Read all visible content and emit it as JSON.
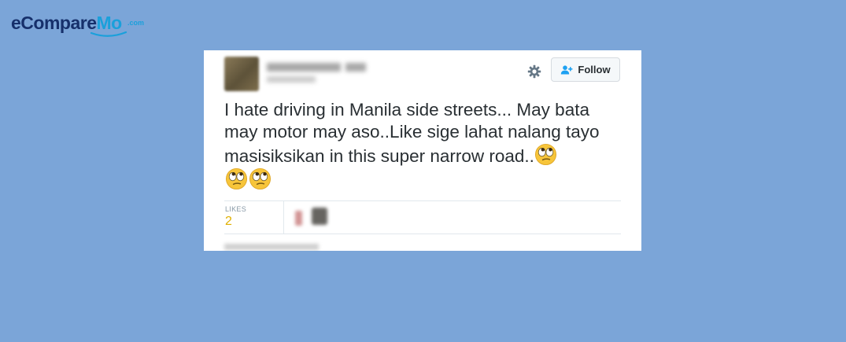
{
  "logo": {
    "e": "e",
    "compare": "Compare",
    "mo": "Mo",
    "suffix": ".com"
  },
  "tweet": {
    "follow_label": "Follow",
    "text": "I hate driving in Manila side streets... May bata may motor may aso..Like sige lahat nalang tayo masisiksikan in this super narrow road..",
    "emoji_count": 3,
    "emoji_name": "face-with-rolling-eyes",
    "likes_label": "LIKES",
    "likes_count": "2"
  },
  "colors": {
    "background": "#7ba5d8",
    "likes_count": "#e0b000",
    "follow_icon": "#1da1f2"
  }
}
